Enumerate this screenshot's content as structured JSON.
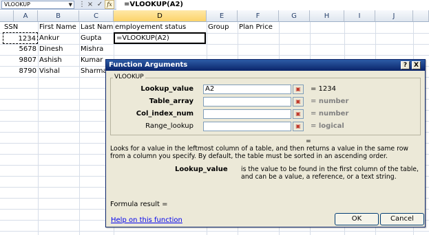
{
  "formula_bar": {
    "name_box": "VLOOKUP",
    "cancel_icon": "×",
    "enter_icon": "✓",
    "fx_label": "fx",
    "formula": "=VLOOKUP(A2)"
  },
  "grid": {
    "columns": [
      "A",
      "B",
      "C",
      "D",
      "E",
      "F",
      "G",
      "H",
      "I",
      "J"
    ],
    "selected_column": "D",
    "header_row": {
      "a": "SSN",
      "b": "First Name",
      "c": "Last Name",
      "d": "employement status",
      "e": "Group",
      "f": "Plan Price"
    },
    "rows": [
      {
        "a": "1234",
        "b": "Ankur",
        "c": "Gupta",
        "d": "=VLOOKUP(A2)"
      },
      {
        "a": "5678",
        "b": "Dinesh",
        "c": "Mishra",
        "d": ""
      },
      {
        "a": "9807",
        "b": "Ashish",
        "c": "Kumar",
        "d": ""
      },
      {
        "a": "8790",
        "b": "Vishal",
        "c": "Sharma",
        "d": ""
      }
    ]
  },
  "dialog": {
    "title": "Function Arguments",
    "help_btn": "?",
    "close_btn": "X",
    "function_name": "VLOOKUP",
    "args": [
      {
        "label": "Lookup_value",
        "value": "A2",
        "result": "= 1234"
      },
      {
        "label": "Table_array",
        "value": "",
        "result": "= number"
      },
      {
        "label": "Col_index_num",
        "value": "",
        "result": "= number"
      },
      {
        "label": "Range_lookup",
        "value": "",
        "result": "= logical"
      }
    ],
    "overall_result": "=",
    "description": "Looks for a value in the leftmost column of a table, and then returns a value in the same row from a column you specify. By default, the table must be sorted in an ascending order.",
    "arg_help_name": "Lookup_value",
    "arg_help_text": "is the value to be found in the first column of the table, and can be a value, a reference, or a text string.",
    "formula_result": "Formula result =",
    "help_link": "Help on this function",
    "ok": "OK",
    "cancel": "Cancel"
  }
}
